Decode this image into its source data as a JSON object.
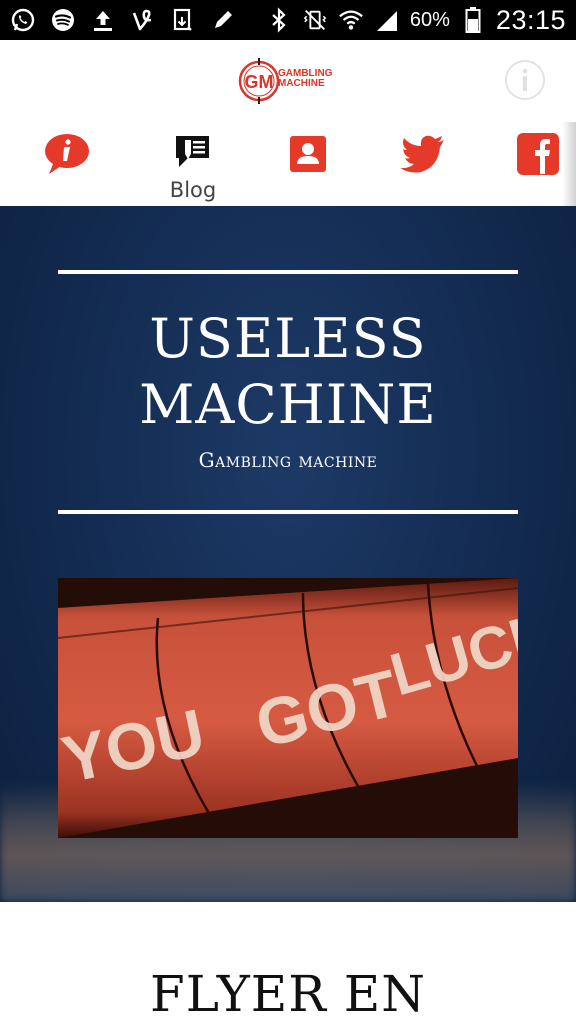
{
  "status_bar": {
    "left_icons": [
      "whatsapp-icon",
      "spotify-icon",
      "upload-icon",
      "vine-icon",
      "download-file-icon",
      "pencil-icon"
    ],
    "right_icons": [
      "bluetooth-icon",
      "vibrate-icon",
      "wifi-icon",
      "signal-icon",
      "battery-icon"
    ],
    "battery": "60%",
    "time": "23:15"
  },
  "header": {
    "logo_text_line1": "GAMBLING",
    "logo_text_line2": "MACHINE",
    "logo_mark": "GM",
    "info_icon": "info-circle-icon"
  },
  "nav": {
    "items": [
      {
        "icon": "info-bubble-icon",
        "label": ""
      },
      {
        "icon": "blog-icon",
        "label": "Blog"
      },
      {
        "icon": "contact-icon",
        "label": ""
      },
      {
        "icon": "twitter-icon",
        "label": ""
      },
      {
        "icon": "facebook-icon",
        "label": ""
      }
    ],
    "accent": "#e53a2a"
  },
  "hero": {
    "title_line1": "USELESS",
    "title_line2": "MACHINE",
    "subtitle": "Gambling machine",
    "image_words": [
      "YOU",
      "GOT",
      "LUCKY"
    ]
  },
  "section": {
    "title": "FLYER EN"
  }
}
